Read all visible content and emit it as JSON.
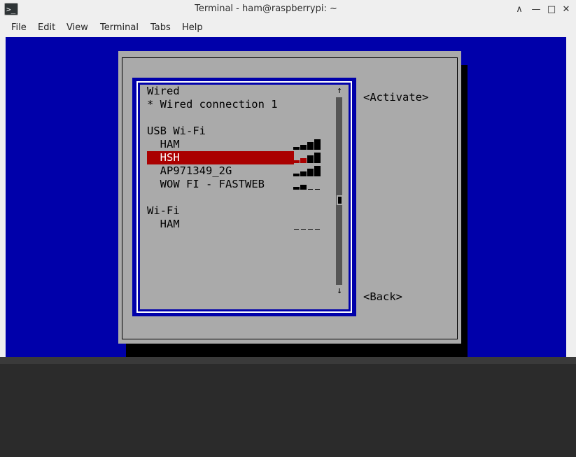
{
  "window": {
    "title": "Terminal - ham@raspberrypi: ~",
    "controls": {
      "collapse": "∧",
      "minimize": "—",
      "maximize": "□",
      "close": "✕"
    }
  },
  "menu": [
    "File",
    "Edit",
    "View",
    "Terminal",
    "Tabs",
    "Help"
  ],
  "nmtui": {
    "sections": [
      {
        "label": "Wired",
        "items": [
          {
            "label": "* Wired connection 1"
          }
        ]
      },
      {
        "label": "USB Wi-Fi",
        "items": [
          {
            "label": "HAM",
            "signal": 4,
            "selected": false
          },
          {
            "label": "HSH",
            "signal": 4,
            "selected": true
          },
          {
            "label": "AP971349_2G",
            "signal": 4,
            "selected": false
          },
          {
            "label": "WOW FI - FASTWEB",
            "signal": 2,
            "selected": false
          }
        ]
      },
      {
        "label": "Wi-Fi",
        "items": [
          {
            "label": "HAM",
            "signal": 0,
            "selected": false
          }
        ]
      }
    ],
    "scroll_up": "↑",
    "scroll_down": "↓",
    "actions": {
      "activate": "<Activate>",
      "back": "<Back>"
    }
  },
  "colors": {
    "terminal_bg": "#0000aa",
    "dialog_bg": "#aaaaaa",
    "selection": "#aa0000"
  }
}
